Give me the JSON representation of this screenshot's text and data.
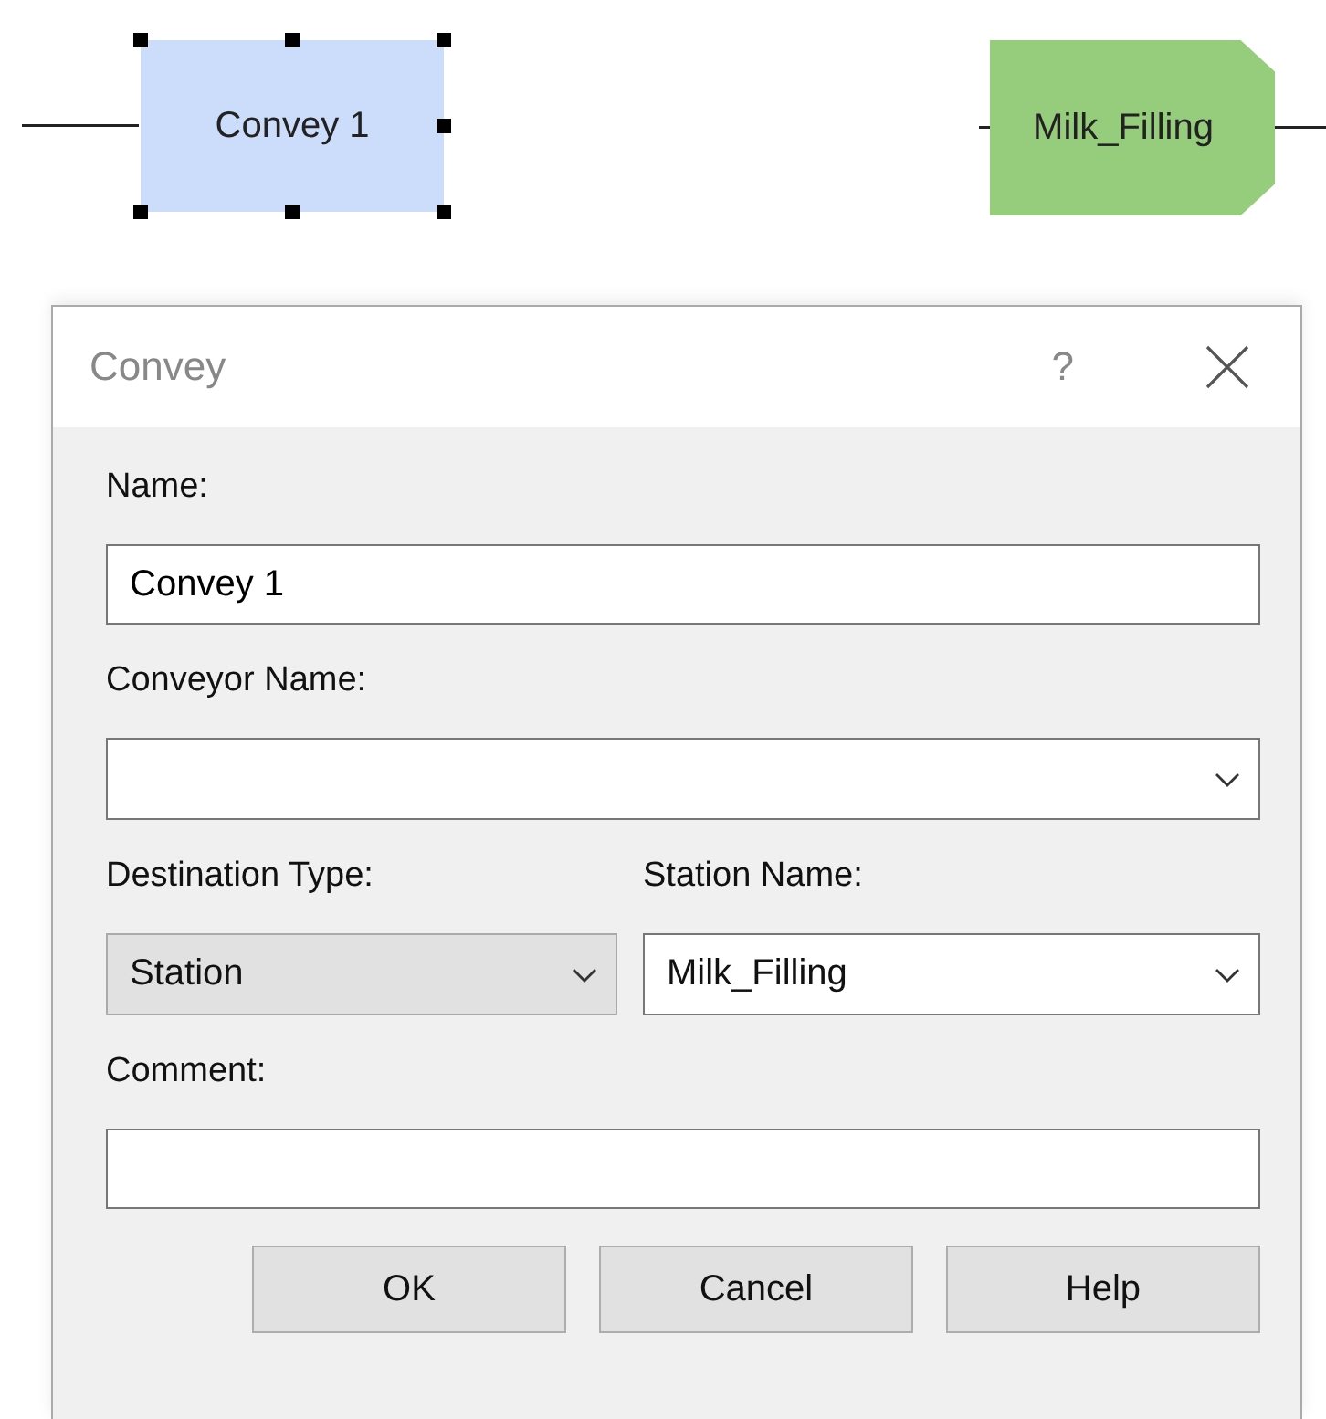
{
  "diagram": {
    "nodes": [
      {
        "kind": "process",
        "label": "Convey 1",
        "selected": true
      },
      {
        "kind": "station",
        "label": "Milk_Filling",
        "selected": false
      }
    ]
  },
  "dialog": {
    "title": "Convey",
    "help": "?",
    "rows": [
      [
        {
          "label": "Name:",
          "kind": "text",
          "value": "Convey 1"
        }
      ],
      [
        {
          "label": "Conveyor Name:",
          "kind": "dropdown",
          "editable": true
        }
      ],
      [
        {
          "label": "Destination Type:",
          "kind": "dropdown",
          "value": "Station",
          "editable": false
        },
        {
          "label": "Station Name:",
          "kind": "dropdown",
          "value": "Milk_Filling",
          "editable": true
        }
      ],
      [
        {
          "label": "Comment:",
          "kind": "text"
        }
      ]
    ],
    "buttons": [
      "OK",
      "Cancel",
      "Help"
    ]
  }
}
